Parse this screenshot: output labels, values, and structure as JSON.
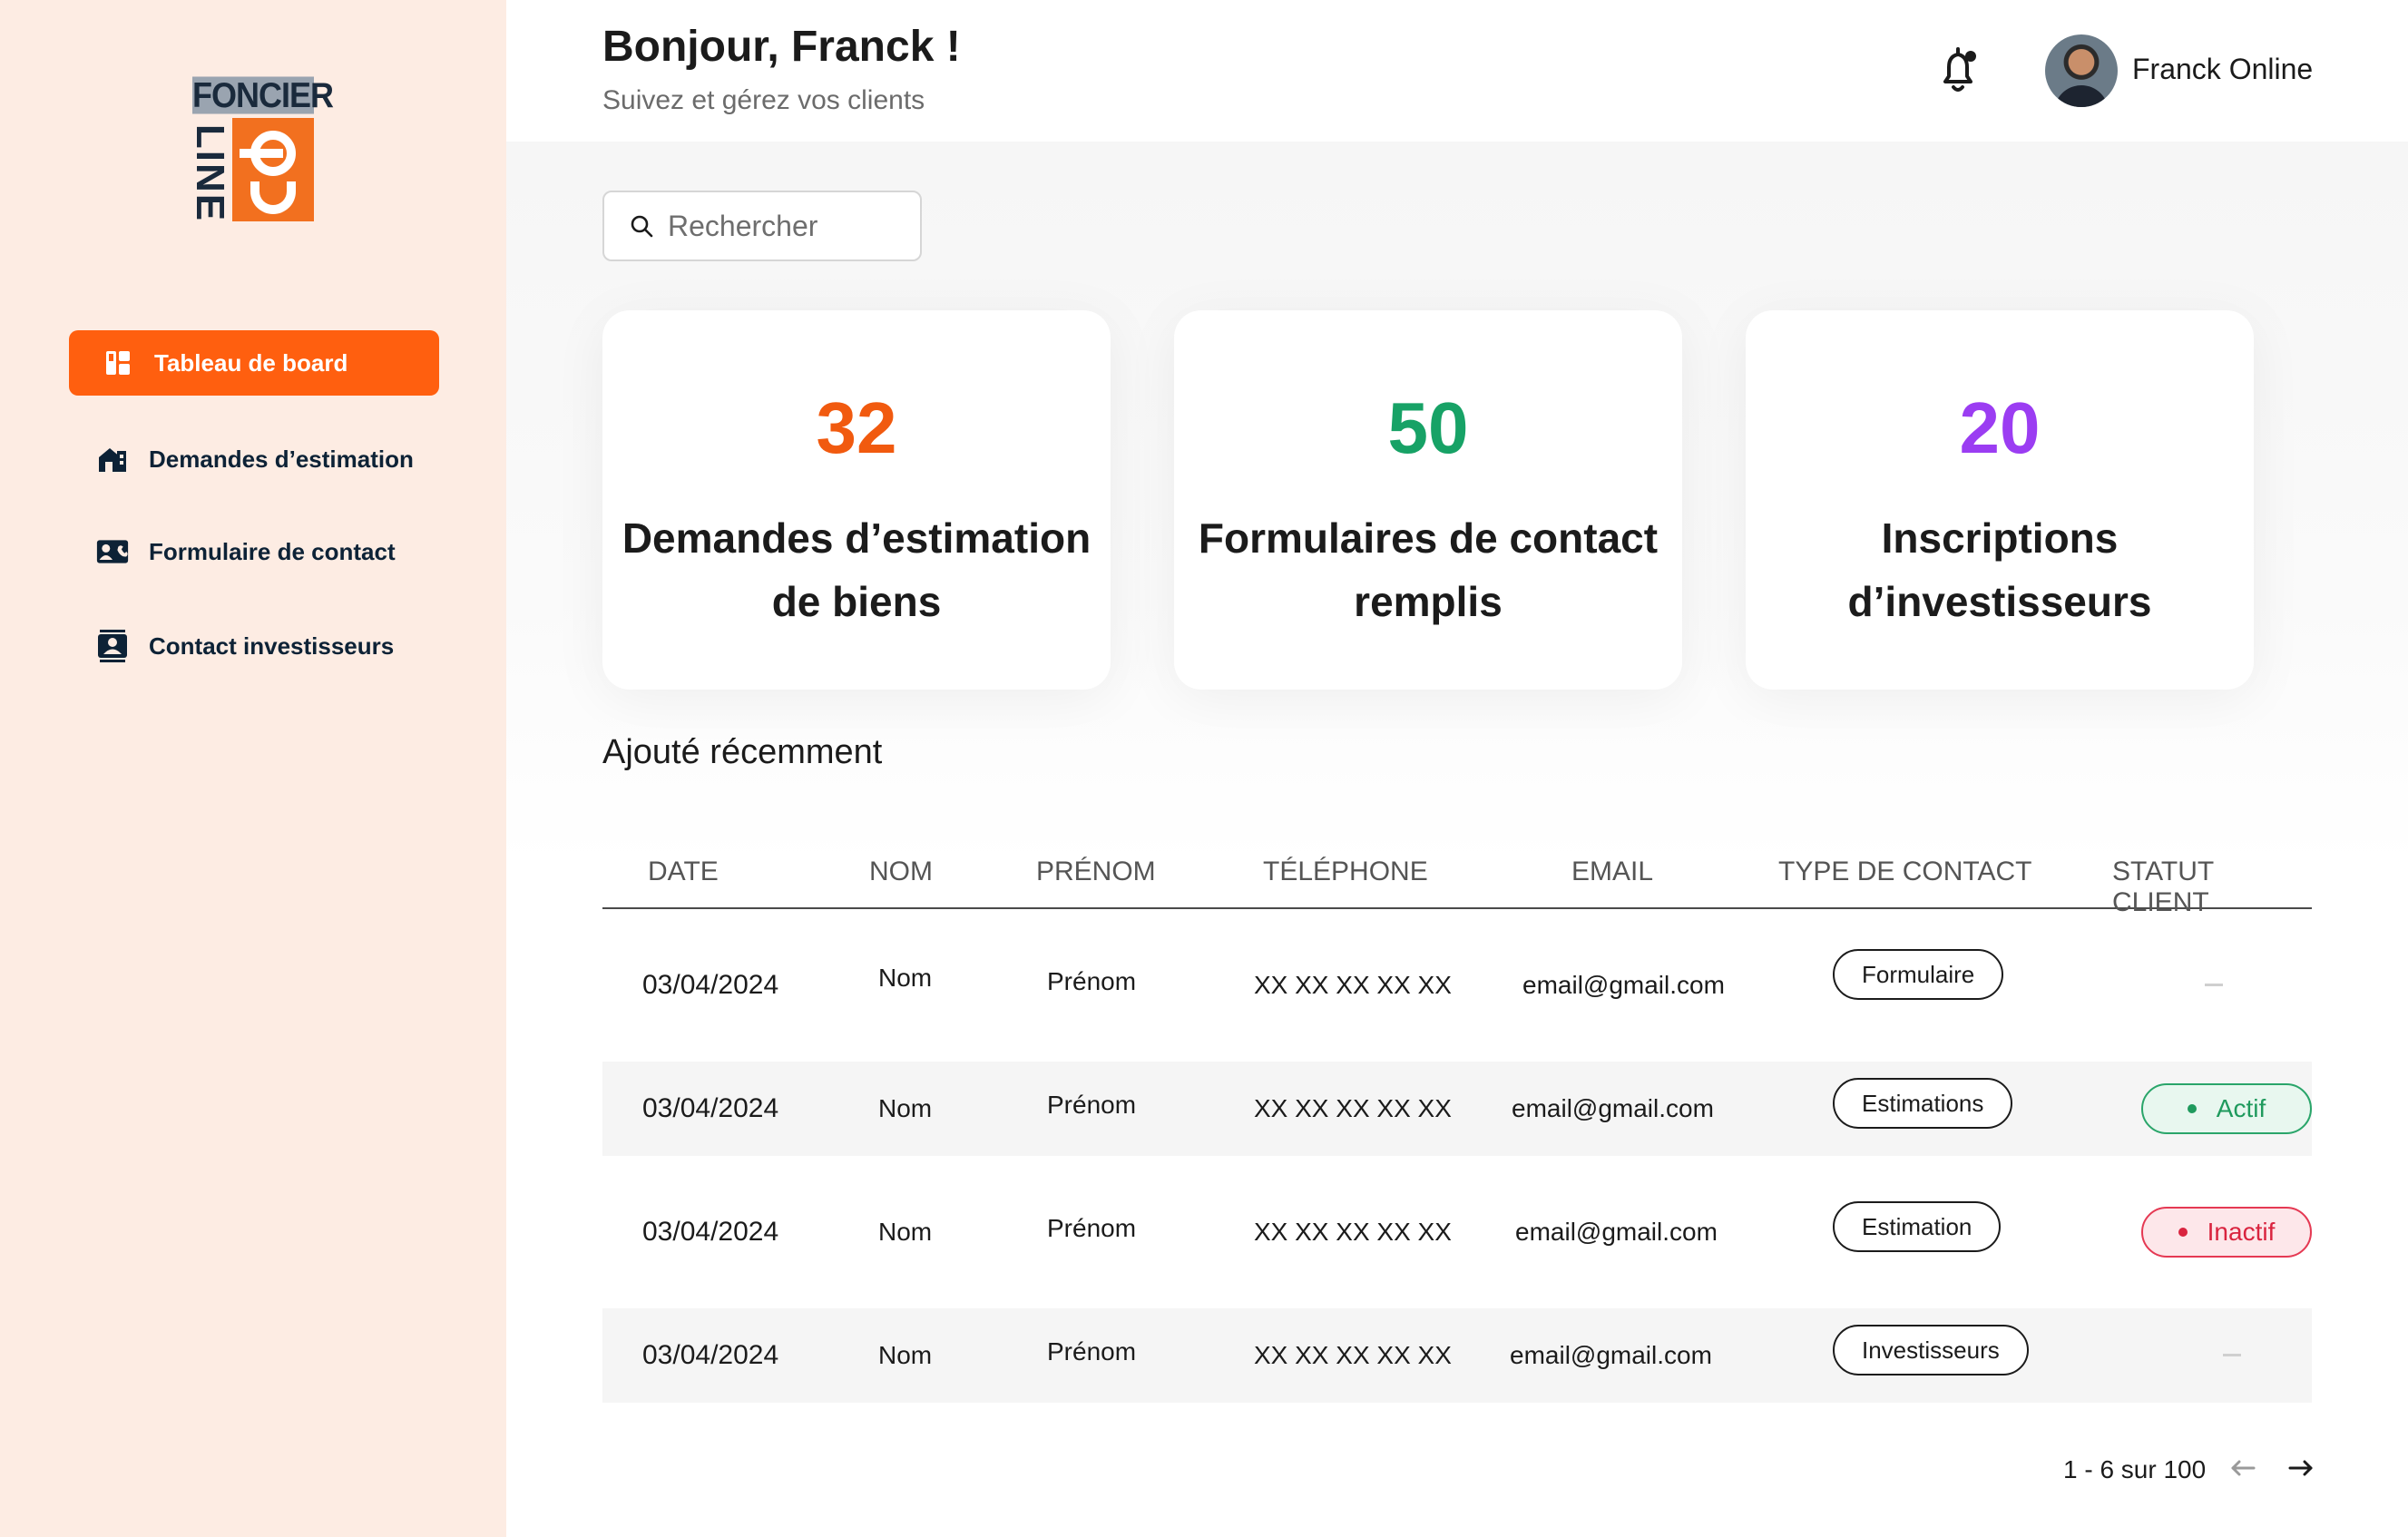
{
  "brand": {
    "logo_top": "FONCIER",
    "logo_line": "LINE",
    "logo_on": "On",
    "accent": "#ff5f0f"
  },
  "sidebar": {
    "items": [
      {
        "label": "Tableau de board",
        "icon": "dashboard-icon",
        "active": true
      },
      {
        "label": "Demandes d’estimation",
        "icon": "house-icon",
        "active": false
      },
      {
        "label": "Formulaire de contact",
        "icon": "contact-card-icon",
        "active": false
      },
      {
        "label": "Contact investisseurs",
        "icon": "contact-book-icon",
        "active": false
      }
    ]
  },
  "header": {
    "greeting": "Bonjour, Franck !",
    "subtitle": "Suivez et gérez vos clients",
    "notification_icon": "bell-icon",
    "user_name": "Franck Online"
  },
  "search": {
    "placeholder": "Rechercher",
    "value": ""
  },
  "stats": [
    {
      "value": "32",
      "label": "Demandes d’estimation de biens",
      "color": "#f15a0f"
    },
    {
      "value": "50",
      "label": "Formulaires de contact remplis",
      "color": "#17a266"
    },
    {
      "value": "20",
      "label": "Inscriptions d’investisseurs",
      "color": "#9b3df2"
    }
  ],
  "recent": {
    "title": "Ajouté récemment",
    "columns": [
      "DATE",
      "NOM",
      "PRÉNOM",
      "TÉLÉPHONE",
      "EMAIL",
      "TYPE DE CONTACT",
      "STATUT CLIENT"
    ],
    "rows": [
      {
        "date": "03/04/2024",
        "nom": "Nom",
        "prenom": "Prénom",
        "telephone": "XX XX XX XX XX",
        "email": "email@gmail.com",
        "type": "Formulaire",
        "statut": "—"
      },
      {
        "date": "03/04/2024",
        "nom": "Nom",
        "prenom": "Prénom",
        "telephone": "XX XX XX XX XX",
        "email": "email@gmail.com",
        "type": "Estimations",
        "statut": "Actif"
      },
      {
        "date": "03/04/2024",
        "nom": "Nom",
        "prenom": "Prénom",
        "telephone": "XX XX XX XX XX",
        "email": "email@gmail.com",
        "type": "Estimation",
        "statut": "Inactif"
      },
      {
        "date": "03/04/2024",
        "nom": "Nom",
        "prenom": "Prénom",
        "telephone": "XX XX XX XX XX",
        "email": "email@gmail.com",
        "type": "Investisseurs",
        "statut": "—"
      }
    ],
    "status_colors": {
      "Actif": "#1f9a5d",
      "Inactif": "#d9243f"
    }
  },
  "pagination": {
    "label": "1 - 6 sur 100",
    "prev_icon": "arrow-left-icon",
    "next_icon": "arrow-right-icon"
  }
}
